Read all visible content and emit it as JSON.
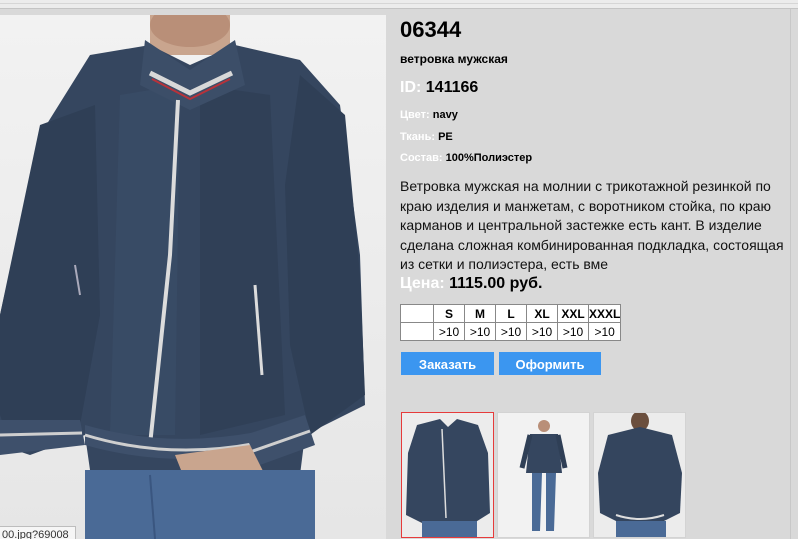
{
  "product": {
    "article": "06344",
    "name": "ветровка мужская",
    "id_label": "ID:",
    "id_value": "141166",
    "color_label": "Цвет:",
    "color_value": "navy",
    "fabric_label": "Ткань:",
    "fabric_value": "PE",
    "composition_label": "Состав:",
    "composition_value": "100%Полиэстер",
    "description": "Ветровка мужская на молнии с трикотажной резинкой по краю изделия и манжетам, с воротником стойка, по краю карманов и центральной застежке есть кант. В изделие сделана сложная комбинированная подкладка, состоящая из  сетки и полиэстера, есть вме",
    "price_label": "Цена:",
    "price_value": "1115.00 руб."
  },
  "sizes": {
    "headers": [
      "S",
      "M",
      "L",
      "XL",
      "XXL",
      "XXXL"
    ],
    "stock": [
      ">10",
      ">10",
      ">10",
      ">10",
      ">10",
      ">10"
    ]
  },
  "actions": {
    "order_label": "Заказать",
    "checkout_label": "Оформить"
  },
  "status": {
    "url_tooltip": "00.jpg?69008"
  },
  "colors": {
    "jacket": "#34455e",
    "accent_button": "#3b96f0",
    "selected_thumb_border": "#e63b3b",
    "panel_bg": "#d9d9d9"
  },
  "icons": {
    "main_photo": "jacket-front-photo",
    "thumbs": [
      "jacket-front-thumb",
      "jacket-full-body-thumb",
      "jacket-back-thumb"
    ]
  }
}
